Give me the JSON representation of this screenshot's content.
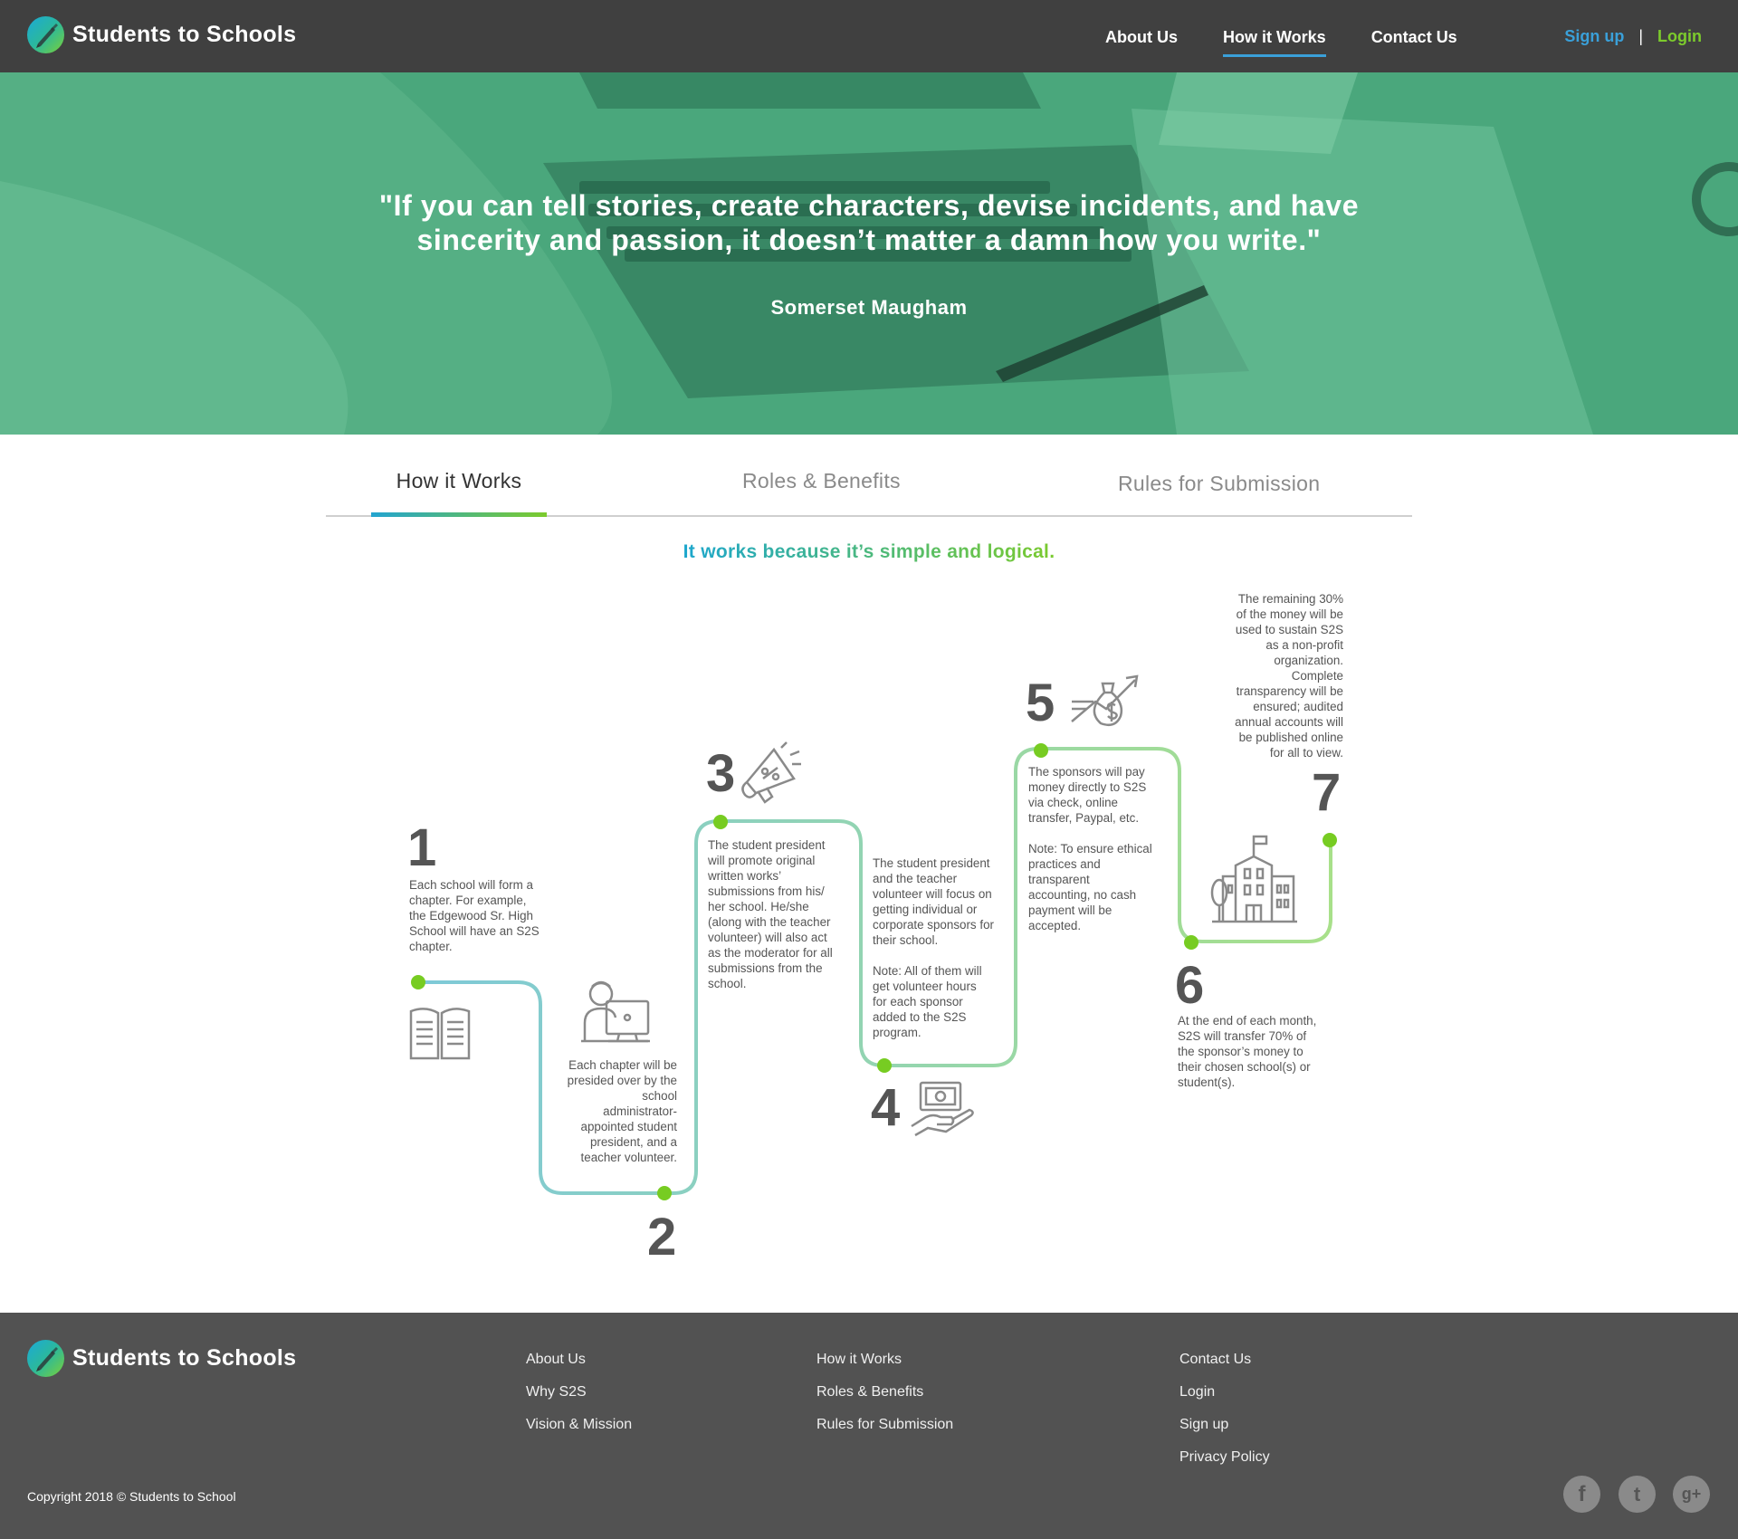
{
  "brand": {
    "name": "Students to Schools",
    "logo_icon": "pen-nib-icon",
    "logo_gradient": [
      "#1ba9d8",
      "#7cd136"
    ]
  },
  "nav": {
    "links": [
      "About Us",
      "How it Works",
      "Contact Us"
    ],
    "active": "How it Works",
    "signup": "Sign up",
    "separator": "|",
    "login": "Login"
  },
  "hero": {
    "quote_line1": "\"If you can tell stories, create characters, devise incidents, and have",
    "quote_line2": "sincerity and passion, it doesn’t matter a damn how you write.\"",
    "author": "Somerset Maugham",
    "overlay_color": "#3fa876"
  },
  "tabs": {
    "items": [
      "How it Works",
      "Roles & Benefits",
      "Rules for Submission"
    ],
    "active": "How it Works"
  },
  "tagline": "It works because it’s simple and logical.",
  "steps": [
    {
      "number": "1",
      "icon": "book-icon",
      "text": [
        "Each school will form a",
        "chapter. For example,",
        "the Edgewood Sr. High",
        "School will have an S2S",
        "chapter."
      ]
    },
    {
      "number": "2",
      "icon": "student-computer-icon",
      "text": [
        "Each chapter will be",
        "presided over by the",
        "school",
        "administrator-",
        "appointed student",
        "president, and a",
        "teacher volunteer."
      ]
    },
    {
      "number": "3",
      "icon": "megaphone-icon",
      "text": [
        "The student president",
        "will promote original",
        "written works’",
        "submissions from his/",
        "her school. He/she",
        "(along with the teacher",
        "volunteer) will also act",
        "as the moderator for all",
        "submissions from the",
        "school."
      ]
    },
    {
      "number": "4",
      "icon": "hand-money-icon",
      "text": [
        "The student president",
        "and the teacher",
        "volunteer will focus on",
        "getting individual or",
        "corporate sponsors for",
        "their school.",
        "",
        "Note: All of them will",
        "get volunteer hours",
        "for each sponsor",
        "added to the S2S",
        "program."
      ]
    },
    {
      "number": "5",
      "icon": "money-bag-growth-icon",
      "text": [
        "The sponsors will pay",
        "money directly to S2S",
        "via check, online",
        "transfer, Paypal, etc.",
        "",
        "Note: To ensure ethical",
        "practices and",
        "transparent",
        "accounting, no cash",
        "payment will be",
        "accepted."
      ]
    },
    {
      "number": "6",
      "icon": "none",
      "text": [
        "At the end of each month,",
        "S2S will transfer 70% of",
        "the sponsor’s money to",
        "their chosen school(s) or",
        "student(s)."
      ]
    },
    {
      "number": "7",
      "icon": "school-building-icon",
      "text": [
        "The remaining 30%",
        "of the money will be",
        "used to sustain S2S",
        "as a non-profit",
        "organization.",
        "Complete",
        "transparency will be",
        "ensured; audited",
        "annual accounts will",
        "be published online",
        "for all to view."
      ]
    }
  ],
  "path_colors": {
    "start": "#7ec9d8",
    "end": "#a8e08a",
    "dot": "#77cc22"
  },
  "footer": {
    "brand": "Students to Schools",
    "col1": [
      "About Us",
      "Why S2S",
      "Vision & Mission"
    ],
    "col2": [
      "How it Works",
      "Roles & Benefits",
      "Rules for Submission"
    ],
    "col3": [
      "Contact Us",
      "Login",
      "Sign up",
      "Privacy Policy"
    ],
    "copyright": "Copyright 2018 ©  Students to School",
    "social": [
      {
        "icon": "facebook-icon",
        "glyph": "f"
      },
      {
        "icon": "twitter-icon",
        "glyph": "t"
      },
      {
        "icon": "google-plus-icon",
        "glyph": "g+"
      }
    ]
  }
}
